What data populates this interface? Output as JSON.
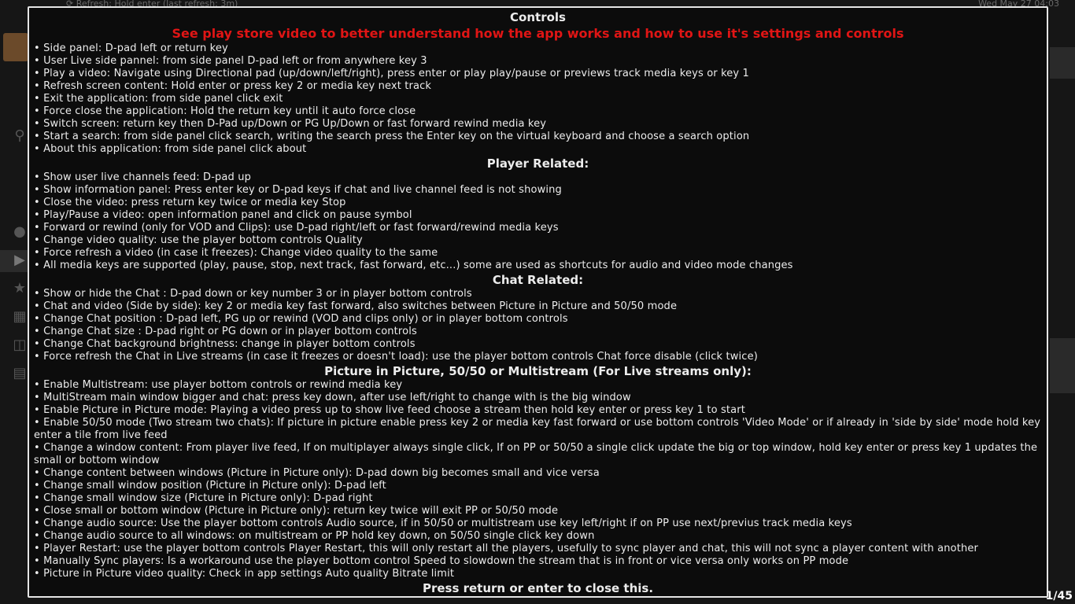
{
  "background": {
    "topbar_left": "⟳ Refresh: Hold enter (last refresh: 3m)",
    "topbar_right": "Wed May 27 04:03",
    "counter": "1/45"
  },
  "dialog": {
    "title": "Controls",
    "subtitle": "See play store video to better understand how the app works and how to use it's settings and controls",
    "general": [
      "• Side panel: D-pad left or return key",
      "• User Live side pannel: from side panel D-pad left or from anywhere key 3",
      "• Play a video: Navigate using Directional pad (up/down/left/right), press enter or play play/pause or previews track media keys or key 1",
      "• Refresh screen content: Hold enter or press key 2 or media key next track",
      "• Exit the application: from side panel click exit",
      "• Force close the application: Hold the return key until it auto force close",
      "• Switch screen: return key then D-Pad up/Down or PG Up/Down or fast forward rewind media key",
      "• Start a search: from side panel click search, writing the search press the Enter key on the virtual keyboard and choose a search option",
      "• About this application: from side panel click about"
    ],
    "player_title": "Player Related:",
    "player": [
      "• Show user live channels feed: D-pad up",
      "• Show information panel: Press enter key or D-pad keys if chat and live channel feed is not showing",
      "• Close the video: press return key twice or media key Stop",
      "• Play/Pause a video: open information panel and click on pause symbol",
      "• Forward or rewind (only for VOD and Clips): use D-pad right/left or fast forward/rewind media keys",
      "• Change video quality: use the player bottom controls Quality",
      "• Force refresh a video (in case it freezes): Change video quality to the same",
      "• All media keys are supported (play, pause, stop, next track, fast forward, etc...) some are used as shortcuts for audio and video mode changes"
    ],
    "chat_title": "Chat Related:",
    "chat": [
      "• Show or hide the Chat : D-pad down or key number 3 or in player bottom controls",
      "• Chat and video (Side by side): key 2 or media key fast forward, also switches between Picture in Picture and 50/50 mode",
      "• Change Chat position : D-pad left, PG up or rewind (VOD and clips only) or in player bottom controls",
      "• Change Chat size : D-pad right or PG down or in player bottom controls",
      "• Change Chat background brightness: change in player bottom controls",
      "• Force refresh the Chat in Live streams (in case it freezes or doesn't load): use the player bottom controls Chat force disable (click twice)"
    ],
    "pip_title": "Picture in Picture, 50/50 or Multistream (For Live streams only):",
    "pip": [
      "• Enable Multistream: use player bottom controls or rewind media key",
      "• MultiStream main window bigger and chat: press key down, after use left/right to change with is the big window",
      "• Enable Picture in Picture mode: Playing a video press up to show live feed choose a stream then hold key enter or press key 1 to start",
      "• Enable 50/50 mode (Two stream two chats): If picture in picture enable press key 2 or media key fast forward or use bottom controls 'Video Mode' or if already in 'side by side' mode hold key enter a tile from live feed",
      "• Change a window content: From player live feed, If on multiplayer always single click, If on PP or 50/50 a single click update the big or top window, hold key enter or press key 1 updates the small or bottom window",
      "• Change content between windows (Picture in Picture only): D-pad down big becomes small and vice versa",
      "• Change small window position (Picture in Picture only): D-pad left",
      "• Change small window size (Picture in Picture only): D-pad right",
      "• Close small or bottom window (Picture in Picture only): return key twice will exit PP or 50/50 mode",
      "• Change audio source: Use the player bottom controls Audio source, if in 50/50 or multistream use key left/right if on PP use next/previus track media keys",
      "• Change audio source to all windows: on multistream or PP hold key down, on 50/50 single click key down",
      "• Player Restart: use the player bottom controls Player Restart, this will only restart all the players, usefully to sync player and chat, this will not sync a player content with another",
      "• Manually Sync players: Is a workaround use the player bottom control Speed to slowdown the stream that is in front or vice versa only works on PP mode",
      "• Picture in Picture video quality: Check in app settings Auto quality Bitrate limit"
    ],
    "closing": "Press return or enter to close this."
  }
}
